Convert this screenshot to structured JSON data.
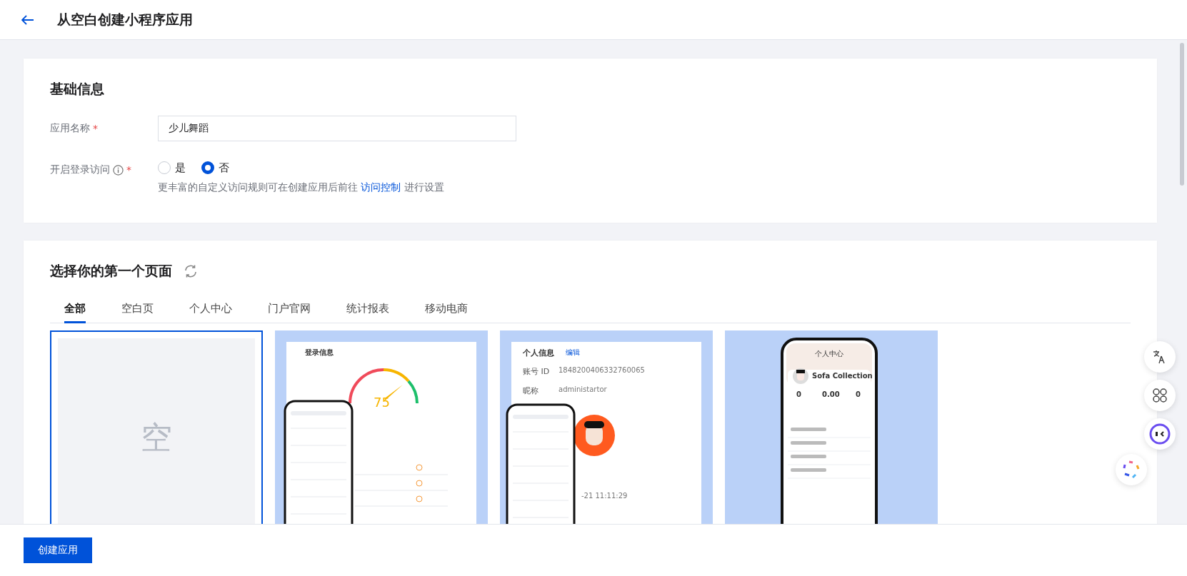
{
  "header": {
    "title": "从空白创建小程序应用"
  },
  "basic_info": {
    "title": "基础信息",
    "fields": [
      {
        "kind": "text",
        "label": "应用名称",
        "mark": "*",
        "value": "少儿舞蹈"
      },
      {
        "kind": "radio",
        "label": "开启登录访问",
        "mark": "*",
        "info": true,
        "options": [
          {
            "label": "是",
            "selected": false
          },
          {
            "label": "否",
            "selected": true
          }
        ],
        "hint": "更丰富的自定义访问规则可在创建应用后前往",
        "hint_link": "访问控制",
        "hint_after": "进行设置"
      }
    ]
  },
  "templates": {
    "title": "选择你的第一个页面",
    "tabs": [
      {
        "label": "全部",
        "selected": true
      },
      {
        "label": "空白页",
        "selected": false
      },
      {
        "label": "个人中心",
        "selected": false
      },
      {
        "label": "门户官网",
        "selected": false
      },
      {
        "label": "统计报表",
        "selected": false
      },
      {
        "label": "移动电商",
        "selected": false
      }
    ],
    "cards": [
      {
        "kind": "blank",
        "selected": true,
        "label": "空"
      },
      {
        "kind": "gauge",
        "selected": false,
        "heading": "登录信息",
        "value": "75"
      },
      {
        "kind": "profile",
        "selected": false,
        "heading": "个人信息",
        "edit": "编辑",
        "rows": [
          {
            "label": "账号 ID",
            "value": "1848200406332760065"
          },
          {
            "label": "昵称",
            "value": "administartor"
          }
        ],
        "time": "-21 11:11:29"
      },
      {
        "kind": "mobile",
        "selected": false,
        "heading": "个人中心",
        "name": "Sofa Collection",
        "stats": [
          "0",
          "0.00",
          "0"
        ]
      }
    ]
  },
  "footer": {
    "button": "创建应用"
  }
}
